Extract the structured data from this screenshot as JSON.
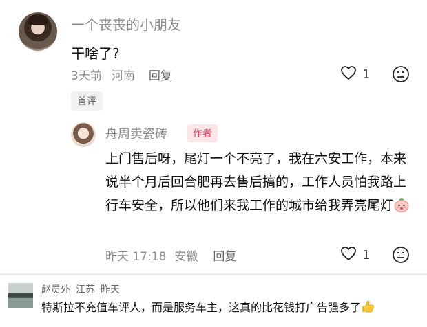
{
  "comment": {
    "username": "一个丧丧的小朋友",
    "text": "干啥了?",
    "time": "3天前",
    "location": "河南",
    "reply_label": "回复",
    "like_count": "1",
    "badge": "首评"
  },
  "reply": {
    "username": "舟周卖瓷砖",
    "author_tag": "作者",
    "text": "上门售后呀，尾灯一个不亮了，我在六安工作，本来说半个月后回合肥再去售后搞的，工作人员怕我路上行车安全，所以他们来我工作的城市给我弄亮尾灯",
    "time": "昨天 17:18",
    "location": "安徽",
    "reply_label": "回复",
    "like_count": "1"
  },
  "bottom_comment": {
    "username": "赵员外",
    "location": "江苏",
    "time": "昨天",
    "text": "特斯拉不充值车评人，而是服务车主，这真的比花钱打广告强多了"
  },
  "colors": {
    "author_tag_bg": "#fde6ea",
    "author_tag_text": "#e2405a",
    "meta_gray": "#8a8a8a"
  },
  "icons": {
    "like": "heart-outline-icon",
    "dislike": "sad-face-icon",
    "emoji": "peach-emoji-icon",
    "thumb": "thumbs-up-emoji-icon"
  }
}
